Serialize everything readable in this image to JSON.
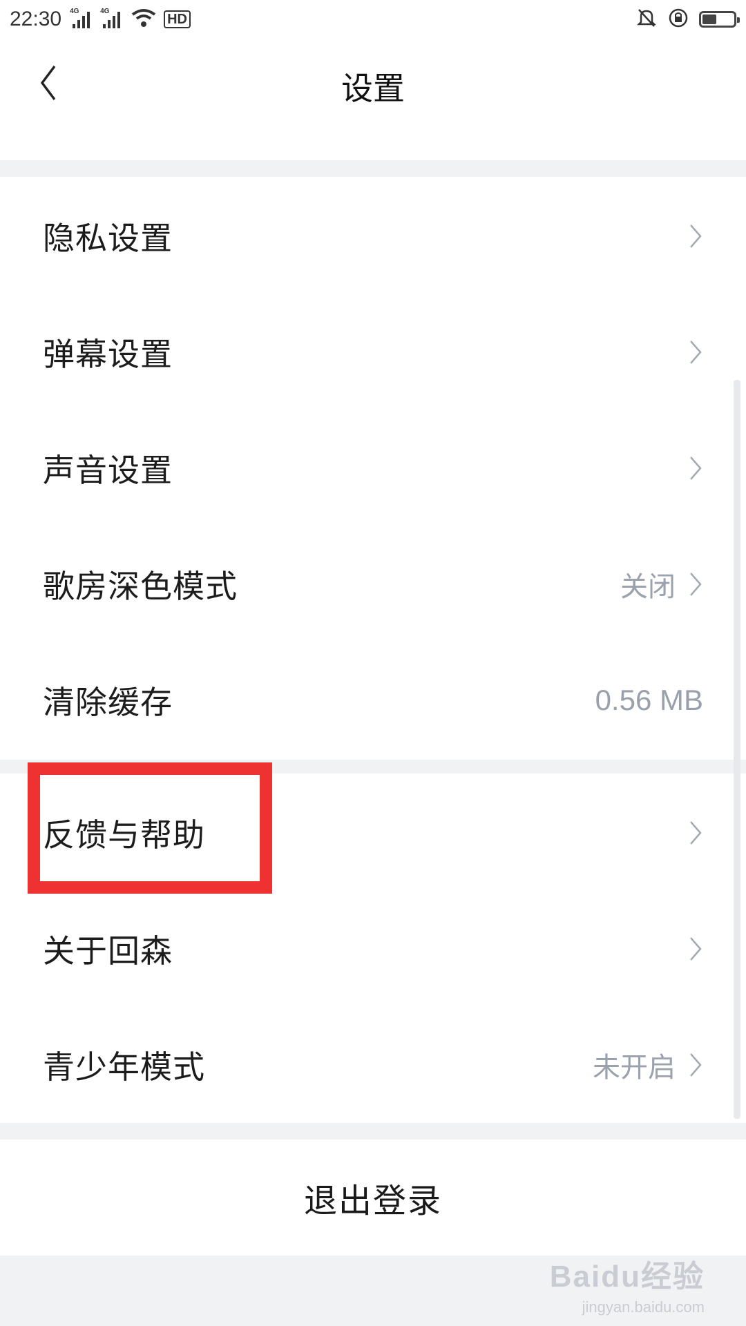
{
  "status_bar": {
    "time": "22:30",
    "network_1": "4G",
    "network_2": "4G",
    "hd": "HD"
  },
  "header": {
    "title": "设置"
  },
  "settings": [
    {
      "label": "隐私设置",
      "value": ""
    },
    {
      "label": "弹幕设置",
      "value": ""
    },
    {
      "label": "声音设置",
      "value": ""
    },
    {
      "label": "歌房深色模式",
      "value": "关闭"
    },
    {
      "label": "清除缓存",
      "value": "0.56 MB"
    },
    {
      "label": "反馈与帮助",
      "value": ""
    },
    {
      "label": "关于回森",
      "value": ""
    },
    {
      "label": "青少年模式",
      "value": "未开启"
    }
  ],
  "logout_label": "退出登录",
  "watermark": {
    "main": "Baidu经验",
    "sub": "jingyan.baidu.com"
  },
  "colors": {
    "highlight": "#ee3232",
    "section_gap": "#f1f2f4",
    "secondary_text": "#9aa2ae"
  }
}
